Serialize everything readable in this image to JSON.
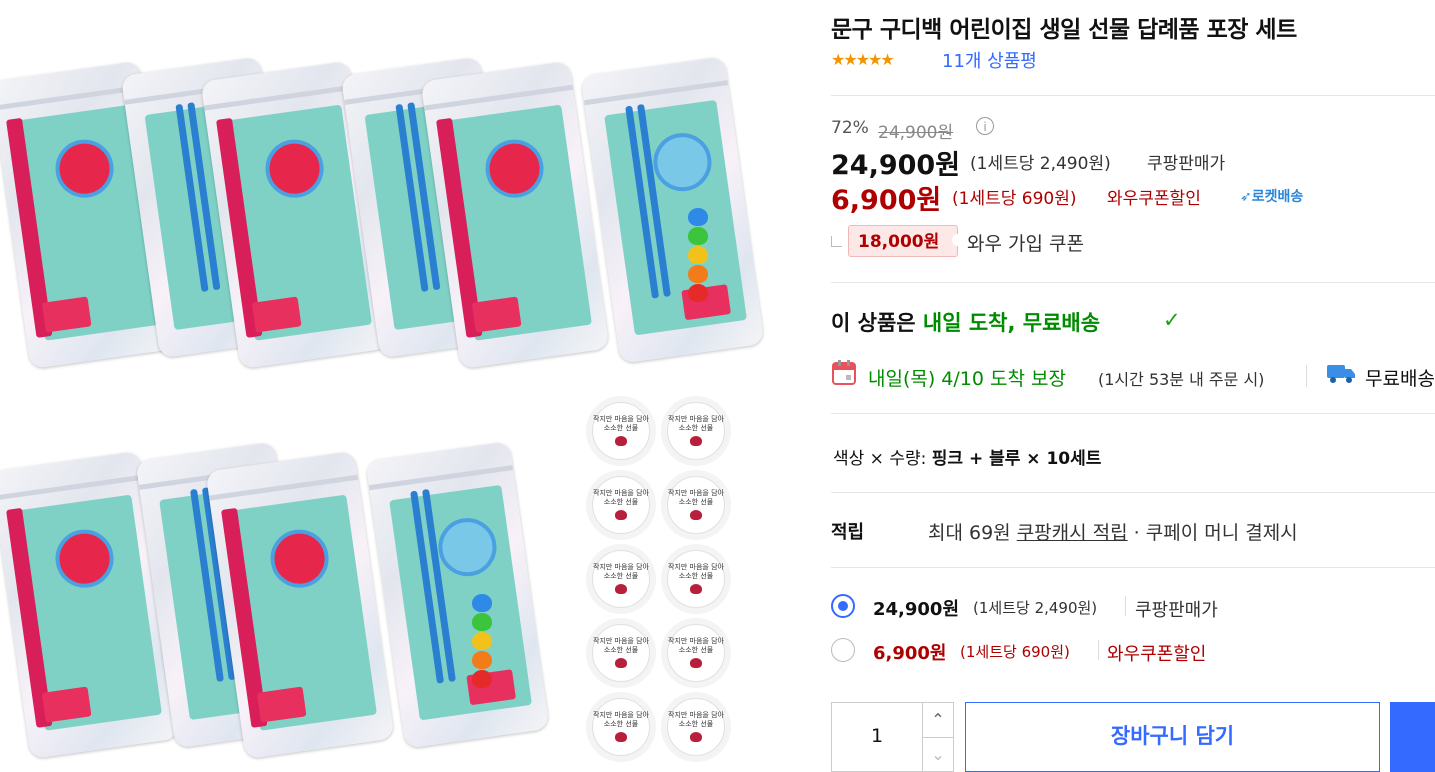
{
  "product": {
    "title": "문구 구디백 어린이집 생일 선물 답례품 포장 세트",
    "stars": "★★★★★",
    "review_count": "11개 상품평"
  },
  "price": {
    "discount_rate": "72%",
    "original": "24,900원",
    "info_icon": "i",
    "sale_price": "24,900원",
    "sale_unit": "(1세트당 2,490원)",
    "sale_label": "쿠팡판매가",
    "wow_price": "6,900원",
    "wow_unit": "(1세트당 690원)",
    "wow_label": "와우쿠폰할인",
    "rocket_label": "로켓배송",
    "coupon_amount": "18,000원",
    "coupon_text": "와우 가입 쿠폰"
  },
  "delivery": {
    "headline_prefix": "이 상품은 ",
    "headline_green": "내일 도착, 무료배송",
    "check_icon": "✓",
    "arrival": "내일(목) 4/10 도착 보장",
    "arrival_sub": "(1시간 53분 내 주문 시)",
    "free": "무료배송"
  },
  "option": {
    "label": "색상 × 수량: ",
    "value": "핑크 + 블루 × 10세트"
  },
  "rewards": {
    "label": "적립",
    "text_prefix": "최대 69원 ",
    "text_link": "쿠팡캐시 적립",
    "text_suffix": " · 쿠페이 머니 결제시"
  },
  "price_options": [
    {
      "price": "24,900원",
      "unit": "(1세트당 2,490원)",
      "label": "쿠팡판매가",
      "selected": true
    },
    {
      "price": "6,900원",
      "unit": "(1세트당 690원)",
      "label": "와우쿠폰할인",
      "selected": false
    }
  ],
  "purchase": {
    "quantity": "1",
    "up_icon": "⌃",
    "down_icon": "⌄",
    "cart_label": "장바구니 담기"
  },
  "sticker_text": "작지만 마음을 담아\n소소한 선물",
  "colors": {
    "accent": "#346aff",
    "red": "#ae0000",
    "green": "#008c00",
    "star": "#f29500"
  }
}
